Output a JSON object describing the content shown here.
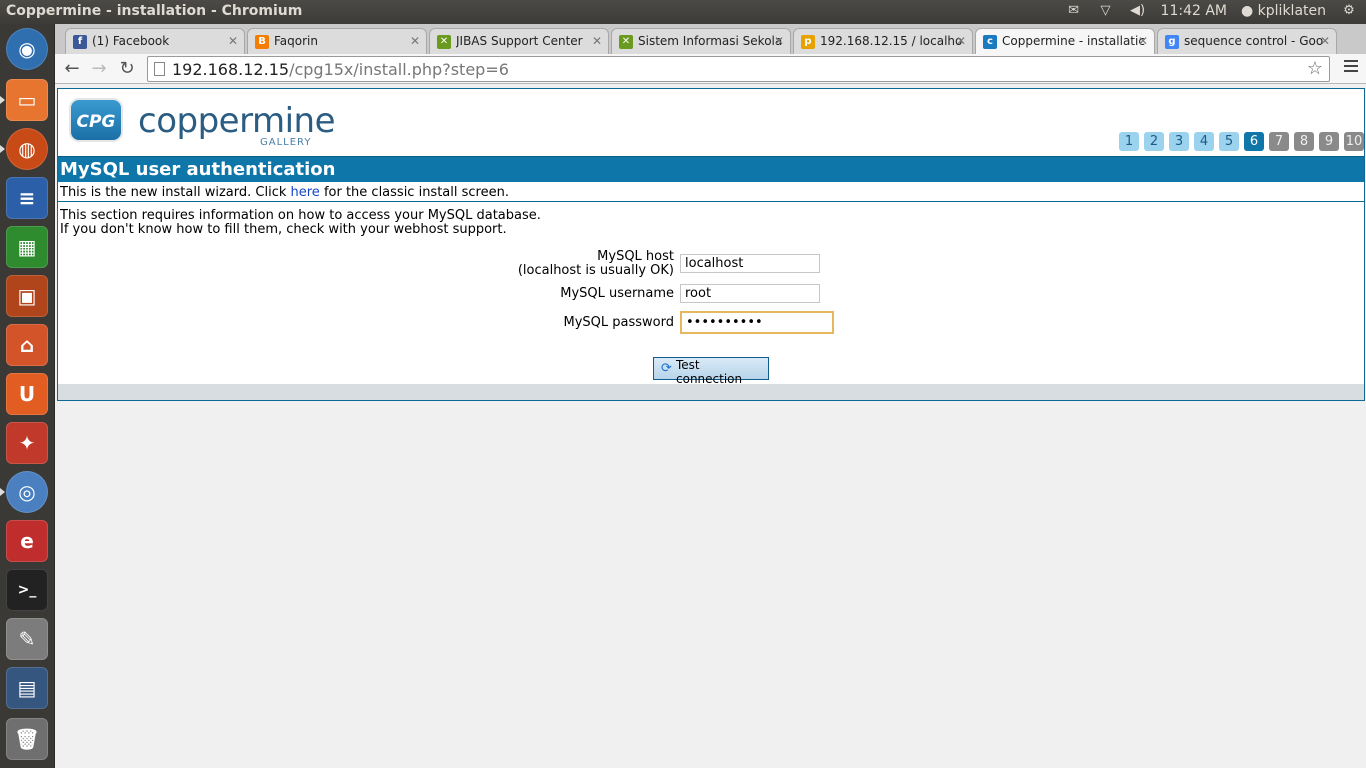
{
  "panel": {
    "window_title": "Coppermine - installation - Chromium",
    "time": "11:42 AM",
    "user": "kpliklaten"
  },
  "tabs": [
    {
      "label": "(1) Facebook",
      "icon": "facebook-icon",
      "color": "#3b5998"
    },
    {
      "label": "Faqorin",
      "icon": "blogger-icon",
      "color": "#f57d00"
    },
    {
      "label": "JIBAS Support Center",
      "icon": "jibas-icon",
      "color": "#6a9a1f"
    },
    {
      "label": "Sistem Informasi Sekola",
      "icon": "jibas-icon",
      "color": "#6a9a1f"
    },
    {
      "label": "192.168.12.15 / localho",
      "icon": "phpmyadmin-icon",
      "color": "#e8a200"
    },
    {
      "label": "Coppermine - installatic",
      "icon": "cpg-icon",
      "color": "#1a7ac0"
    },
    {
      "label": "sequence control - Goo",
      "icon": "google-icon",
      "color": "#4285f4"
    }
  ],
  "address": {
    "host": "192.168.12.15",
    "path": "/cpg15x/install.php?step=6"
  },
  "logo": {
    "mark": "CPG",
    "word": "coppermine",
    "sub": "GALLERY"
  },
  "steps": [
    "1",
    "2",
    "3",
    "4",
    "5",
    "6",
    "7",
    "8",
    "9",
    "10"
  ],
  "current_step": 6,
  "page": {
    "title": "MySQL user authentication",
    "intro_before": "This is the new install wizard. Click ",
    "intro_link": "here",
    "intro_after": " for the classic install screen.",
    "desc_line1": "This section requires information on how to access your MySQL database.",
    "desc_line2": "If you don't know how to fill them, check with your webhost support."
  },
  "form": {
    "host_label": "MySQL host",
    "host_hint": "(localhost is usually OK)",
    "host_value": "localhost",
    "username_label": "MySQL username",
    "username_value": "root",
    "password_label": "MySQL password",
    "password_value": "••••••••••",
    "button_label": "Test connection"
  }
}
